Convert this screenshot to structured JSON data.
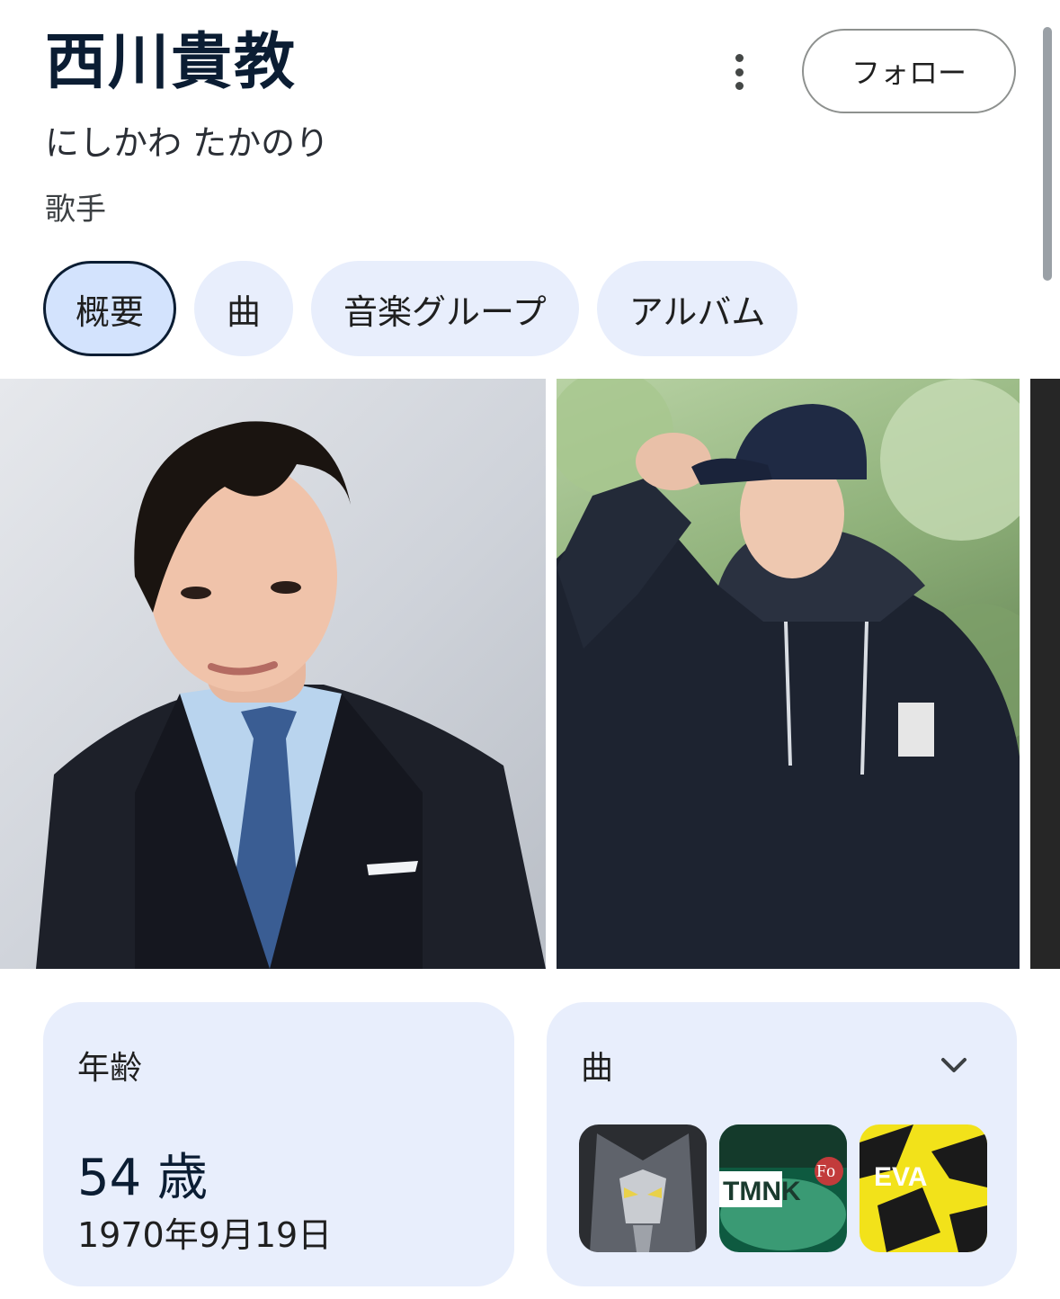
{
  "header": {
    "title": "西川貴教",
    "reading": "にしかわ たかのり",
    "occupation": "歌手",
    "more_icon": "more-vert-icon",
    "follow_label": "フォロー"
  },
  "tabs": [
    {
      "label": "概要",
      "active": true
    },
    {
      "label": "曲",
      "active": false
    },
    {
      "label": "音楽グループ",
      "active": false
    },
    {
      "label": "アルバム",
      "active": false
    }
  ],
  "age_card": {
    "label": "年齢",
    "value": "54 歳",
    "birthdate": "1970年9月19日"
  },
  "songs_card": {
    "label": "曲",
    "expand_icon": "chevron-down-icon",
    "thumbnail_text": [
      "TMNK",
      "Fo",
      "EVA"
    ]
  },
  "colors": {
    "chip_background": "#e8eefc",
    "chip_active_background": "#d3e3fd",
    "title": "#0b1d33"
  }
}
